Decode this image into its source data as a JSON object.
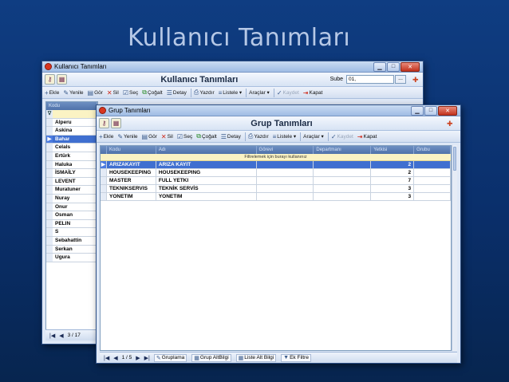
{
  "slide": {
    "title": "Kullanıcı Tanımları"
  },
  "outer_window": {
    "title": "Kullanıcı Tanımları",
    "form_title": "Kullanıcı Tanımları",
    "sube_label": "Sube",
    "sube_value": "01,",
    "sube_button": "...",
    "toolbar": [
      {
        "icon": "+",
        "label": "Ekle",
        "name": "ekle"
      },
      {
        "icon": "✎",
        "label": "Yenile",
        "name": "yenile"
      },
      {
        "icon": "▤",
        "label": "Gör",
        "name": "gor"
      },
      {
        "icon": "✕",
        "label": "Sil",
        "name": "sil"
      },
      {
        "icon": "☑",
        "label": "Seç",
        "name": "sec"
      },
      {
        "icon": "⧉",
        "label": "Çoğalt",
        "name": "cogalt"
      },
      {
        "icon": "☰",
        "label": "Detay",
        "name": "detay"
      },
      {
        "icon": "⎙",
        "label": "Yazdır",
        "name": "yazdir"
      },
      {
        "icon": "≡",
        "label": "Listele ▾",
        "name": "listele"
      },
      {
        "icon": "",
        "label": "Araçlar ▾",
        "name": "araclar"
      },
      {
        "icon": "✓",
        "label": "Kaydet",
        "name": "kaydet"
      },
      {
        "icon": "⇥",
        "label": "Kapat",
        "name": "kapat"
      }
    ],
    "column_header": "Kodu",
    "users": [
      "Alperu",
      "Askina",
      "Bahar",
      "Celals",
      "Ertürk",
      "Haluka",
      "İSMAİLY",
      "LEVENT",
      "Muratuner",
      "Nuray",
      "Onur",
      "Osman",
      "PELIN",
      "S",
      "Sebahattin",
      "Serkan",
      "Ugura"
    ],
    "selected_user_index": 2,
    "nav_text": "3 / 17"
  },
  "inner_window": {
    "title": "Grup Tanımları",
    "form_title": "Grup Tanımları",
    "toolbar": [
      {
        "icon": "+",
        "label": "Ekle",
        "name": "ekle"
      },
      {
        "icon": "✎",
        "label": "Yenile",
        "name": "yenile"
      },
      {
        "icon": "▤",
        "label": "Gör",
        "name": "gor"
      },
      {
        "icon": "✕",
        "label": "Sil",
        "name": "sil"
      },
      {
        "icon": "☑",
        "label": "Seç",
        "name": "sec"
      },
      {
        "icon": "⧉",
        "label": "Çoğalt",
        "name": "cogalt"
      },
      {
        "icon": "☰",
        "label": "Detay",
        "name": "detay"
      },
      {
        "icon": "⎙",
        "label": "Yazdır",
        "name": "yazdir"
      },
      {
        "icon": "≡",
        "label": "Listele ▾",
        "name": "listele"
      },
      {
        "icon": "",
        "label": "Araçlar ▾",
        "name": "araclar"
      },
      {
        "icon": "✓",
        "label": "Kaydet",
        "name": "kaydet"
      },
      {
        "icon": "⇥",
        "label": "Kapat",
        "name": "kapat"
      }
    ],
    "columns": [
      "Kodu",
      "Adı",
      "Görevi",
      "Departmanı",
      "Yetkisi",
      "Grubu"
    ],
    "filter_hint": "Filtrelemek için burayı kullanınız",
    "rows": [
      {
        "kodu": "ARIZAKAYIT",
        "adi": "ARIZA KAYIT",
        "gorevi": "",
        "departmani": "",
        "yetkisi": "2",
        "grubu": ""
      },
      {
        "kodu": "HOUSEKEEPING",
        "adi": "HOUSEKEEPING",
        "gorevi": "",
        "departmani": "",
        "yetkisi": "2",
        "grubu": ""
      },
      {
        "kodu": "MASTER",
        "adi": "FULL YETKI",
        "gorevi": "",
        "departmani": "",
        "yetkisi": "7",
        "grubu": ""
      },
      {
        "kodu": "TEKNIKSERVIS",
        "adi": "TEKNİK SERVİS",
        "gorevi": "",
        "departmani": "",
        "yetkisi": "3",
        "grubu": ""
      },
      {
        "kodu": "YONETIM",
        "adi": "YONETIM",
        "gorevi": "",
        "departmani": "",
        "yetkisi": "3",
        "grubu": ""
      }
    ],
    "selected_row_index": 0,
    "nav_text": "1 / 5",
    "nav_actions": [
      {
        "icon": "✎",
        "label": "Gruplama",
        "name": "gruplama"
      },
      {
        "icon": "▦",
        "label": "Grup AltBilgi",
        "name": "grup-altbilgi"
      },
      {
        "icon": "▦",
        "label": "Liste Alt Bilgi",
        "name": "liste-alt-bilgi"
      },
      {
        "icon": "▼",
        "label": "Ek Filtre",
        "name": "ek-filtre"
      }
    ]
  }
}
